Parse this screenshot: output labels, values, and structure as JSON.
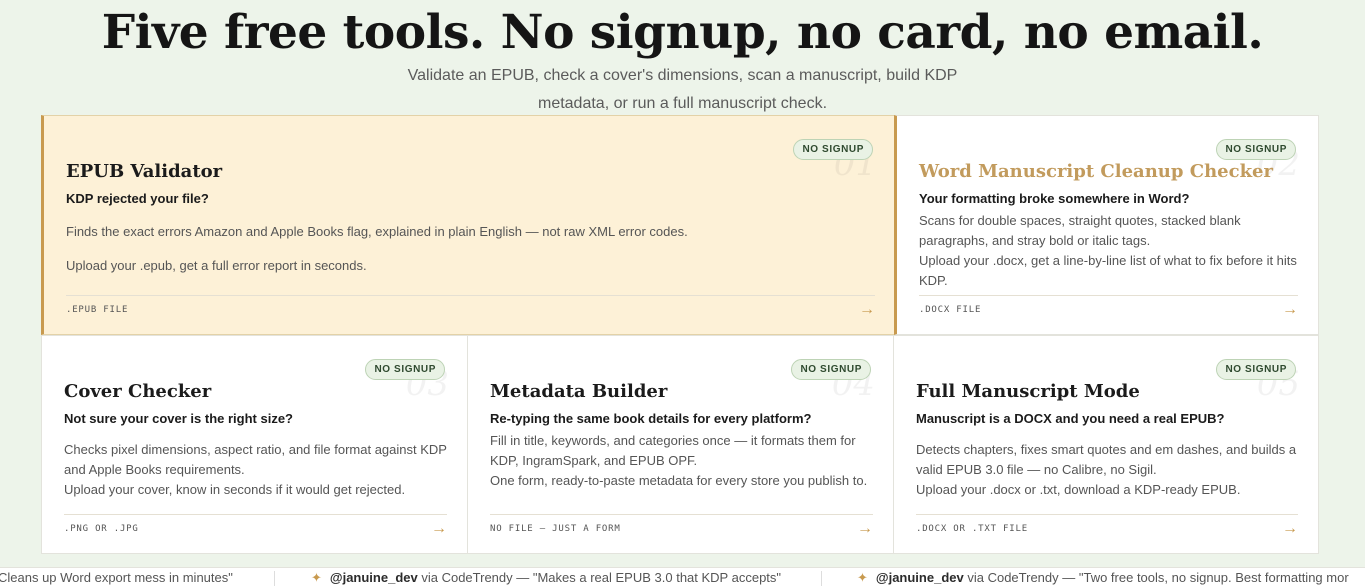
{
  "hero": {
    "title": "Five free tools. No signup, no card, no email.",
    "subtitle_line1": "Validate an EPUB, check a cover's dimensions, scan a manuscript, build KDP",
    "subtitle_line2": "metadata, or run a full manuscript check."
  },
  "tools": [
    {
      "badge": "NO SIGNUP",
      "number": "01",
      "title": "EPUB Validator",
      "question": "KDP rejected your file?",
      "body1": "Finds the exact errors Amazon and Apple Books flag, explained in plain English — not raw XML error codes.",
      "body2": "Upload your .epub, get a full error report in seconds.",
      "foot": ".EPUB FILE",
      "arrow": "→"
    },
    {
      "badge": "NO SIGNUP",
      "number": "02",
      "title": "Word Manuscript Cleanup Checker",
      "question": "Your formatting broke somewhere in Word?",
      "body1": "Scans for double spaces, straight quotes, stacked blank paragraphs, and stray bold or italic tags.",
      "body2": "Upload your .docx, get a line-by-line list of what to fix before it hits KDP.",
      "foot": ".DOCX FILE",
      "arrow": "→"
    },
    {
      "badge": "NO SIGNUP",
      "number": "03",
      "title": "Cover Checker",
      "question": "Not sure your cover is the right size?",
      "body1": "Checks pixel dimensions, aspect ratio, and file format against KDP and Apple Books requirements.",
      "body2": "Upload your cover, know in seconds if it would get rejected.",
      "foot": ".PNG OR .JPG",
      "arrow": "→"
    },
    {
      "badge": "NO SIGNUP",
      "number": "04",
      "title": "Metadata Builder",
      "question": "Re-typing the same book details for every platform?",
      "body1": "Fill in title, keywords, and categories once — it formats them for KDP, IngramSpark, and EPUB OPF.",
      "body2": "One form, ready-to-paste metadata for every store you publish to.",
      "foot": "NO FILE — JUST A FORM",
      "arrow": "→"
    },
    {
      "badge": "NO SIGNUP",
      "number": "05",
      "title": "Full Manuscript Mode",
      "question": "Manuscript is a DOCX and you need a real EPUB?",
      "body1": "Detects chapters, fixes smart quotes and em dashes, and builds a valid EPUB 3.0 file — no Calibre, no Sigil.",
      "body2": "Upload your .docx or .txt, download a KDP-ready EPUB.",
      "foot": ".DOCX OR .TXT FILE",
      "arrow": "→"
    }
  ],
  "ticker": [
    {
      "text": "Cleans up Word export mess in minutes\""
    },
    {
      "star": "✦",
      "handle": "@januine_dev",
      "via": " via CodeTrendy — ",
      "text": "\"Makes a real EPUB 3.0 that KDP accepts\""
    },
    {
      "star": "✦",
      "handle": "@januine_dev",
      "via": " via CodeTrendy — ",
      "text": "\"Two free tools, no signup. Best formatting mor"
    }
  ]
}
